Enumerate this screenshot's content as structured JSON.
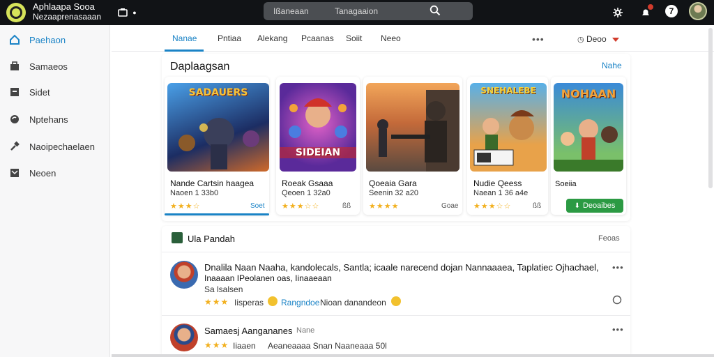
{
  "app": {
    "title": "Aphlaapa Sooa",
    "subtitle": "Nezaaprenasaaan"
  },
  "search": {
    "text1": "Ißaneaan",
    "text2": "Tanagaaion"
  },
  "topbar": {
    "badge_number": "7"
  },
  "sidebar": {
    "items": [
      {
        "label": "Paehaon",
        "icon": "home-icon",
        "active": true
      },
      {
        "label": "Samaeos",
        "icon": "bag-icon"
      },
      {
        "label": "Sidet",
        "icon": "store-icon"
      },
      {
        "label": "Nptehans",
        "icon": "refresh-icon"
      },
      {
        "label": "Naoipechaelaen",
        "icon": "hammer-icon"
      },
      {
        "label": "Neoen",
        "icon": "news-icon"
      }
    ]
  },
  "tabs": {
    "items": [
      {
        "label": "Nanae",
        "active": true
      },
      {
        "label": "Pntiaa"
      },
      {
        "label": "Alekang"
      },
      {
        "label": "Pcaanas"
      },
      {
        "label": "Soiit"
      },
      {
        "label": "Neeo"
      }
    ],
    "more": "•••",
    "sort_label": "Deoo"
  },
  "featured": {
    "title": "Daplaagsan",
    "link": "Nahe",
    "cards": [
      {
        "art_text": "SADAUERS",
        "name": "Nande Cartsin haagea",
        "sub": "Naoen 1 33b0",
        "stars": "★★★☆",
        "meta": "Soet",
        "colors": [
          "#2e6fb8",
          "#14284f"
        ]
      },
      {
        "art_text": "SIDEIAN",
        "name": "Roeak Gsaaa",
        "sub": "Qeoen 1 32a0",
        "stars": "★★★☆☆",
        "meta": "ßß",
        "colors": [
          "#c646b5",
          "#3a1a6e"
        ]
      },
      {
        "art_text": "",
        "name": "Qoeaia Gara",
        "sub": "Seenin 32 a20",
        "stars": "★★★★",
        "meta": "Goae",
        "colors": [
          "#e39a4a",
          "#4b3a34"
        ]
      },
      {
        "art_text": "SNEHALEBE",
        "name": "Nudie Qeess",
        "sub": "Naean 1 36 a4e",
        "stars": "★★★☆☆",
        "meta": "ßß",
        "colors": [
          "#3d9ad6",
          "#c27a2b"
        ]
      },
      {
        "art_text": "NOHAAN",
        "name": "Soeiia",
        "sub": "",
        "stars": "",
        "meta": "",
        "button": "Deoaibes",
        "colors": [
          "#2a78c8",
          "#6fa04a"
        ]
      }
    ]
  },
  "list": {
    "title": "Ula Pandah",
    "link": "Feoas",
    "reviews": [
      {
        "line1": "Dnalila Naan Naaha, kandolecals, Santla; icaale narecend dojan Nannaaaea, Taplatiec Ojhachael,",
        "line2": "Inaaaan IPeolanen oas, Iinaaeaan",
        "line3": "Sa lsalsen",
        "stars": "★★★",
        "tag1": "Iisperas",
        "tag2": "Rangndoe",
        "tag3": "Nioan danandeon",
        "more": "•••"
      },
      {
        "line1": "Samaesj Aangananes",
        "line1_extra": "Nane",
        "stars": "★★★",
        "tag1": "Iiaaen",
        "tag2": "Aeaneaaaa Snan Naaneaaa 50l",
        "more": "•••"
      }
    ]
  }
}
